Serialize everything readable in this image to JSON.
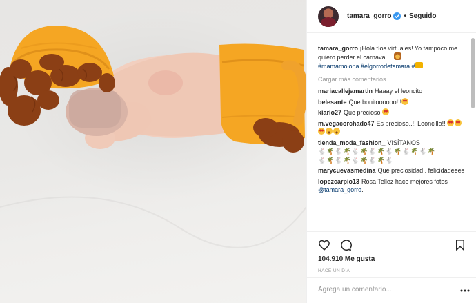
{
  "post": {
    "username": "tamara_gorro",
    "follow_state": "Seguido",
    "separator": "•",
    "caption_text": "¡Hola tíos virtuales! Yo tampoco me quiero perder el carnaval...",
    "hashtags": [
      "#mamamolona",
      "#elgorrodetamara",
      "#"
    ],
    "load_more": "Cargar más comentarios"
  },
  "comments": [
    {
      "user": "mariacallejamartin",
      "text": "Haaay el leoncito"
    },
    {
      "user": "belesante",
      "text": "Que bonitoooooo!!!"
    },
    {
      "user": "kiario27",
      "text": "Que precioso"
    },
    {
      "user": "m.vegacorchado47",
      "text": "Es precioso..!! Leoncillo!!"
    },
    {
      "user": "tienda_moda_fashion_",
      "text": "VISÍTANOS"
    },
    {
      "user": "marycuevasmedina",
      "text": "Que preciosidad . felicidadeees"
    },
    {
      "user": "lopezcarpio13",
      "text": "Rosa Tellez hace mejores fotos",
      "mention": "@tamara_gorro",
      "end": "."
    }
  ],
  "icons": {
    "like": "heart-outline-icon",
    "comment": "speech-bubble-icon",
    "save": "bookmark-icon",
    "verified": "verified-badge-icon",
    "more": "more-options-icon"
  },
  "footer": {
    "likes": "104.910 Me gusta",
    "time": "Hace un día",
    "comment_placeholder": "Agrega un comentario..."
  },
  "colors": {
    "verified": "#3897f0",
    "link": "#003569",
    "muted": "#999999",
    "knit": "#f5a623",
    "mane": "#8b3f15"
  }
}
